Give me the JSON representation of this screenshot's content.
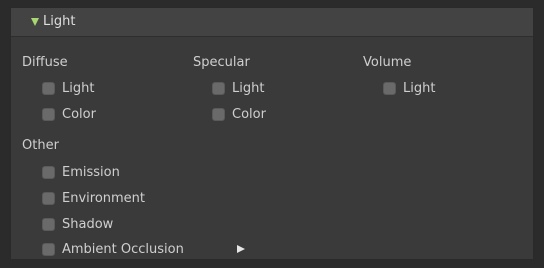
{
  "header": {
    "title": "Light"
  },
  "columns": {
    "diffuse": {
      "title": "Diffuse",
      "items": [
        "Light",
        "Color"
      ]
    },
    "specular": {
      "title": "Specular",
      "items": [
        "Light",
        "Color"
      ]
    },
    "volume": {
      "title": "Volume",
      "items": [
        "Light"
      ]
    }
  },
  "other": {
    "title": "Other",
    "items": [
      "Emission",
      "Environment",
      "Shadow",
      "Ambient Occlusion"
    ]
  },
  "colors": {
    "accent_triangle": "#a7d672",
    "checkbox": "#6a6a6a",
    "panel": "#3a3a3a",
    "header": "#434343"
  }
}
